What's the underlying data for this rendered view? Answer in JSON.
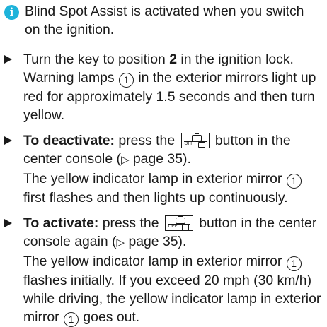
{
  "note": {
    "icon": "info-icon",
    "icon_glyph": "i",
    "text": "Blind Spot Assist is activated when you switch on the ignition."
  },
  "step1": {
    "text_a": "Turn the key to position ",
    "position": "2",
    "text_b": " in the ignition lock. Warning lamps ",
    "callout": "1",
    "text_c": " in the exterior mirrors light up red for approximately 1.5 seconds and then turn yellow."
  },
  "step2": {
    "label": "To deactivate:",
    "text_a": " press the ",
    "button_icon": "blind-spot-assist-button-icon",
    "button_icon_text": "OFF",
    "text_b": " button in the center console (",
    "arrow_glyph": "▷",
    "page_ref": " page 35).",
    "text_c": " The yellow indicator lamp in exterior mirror ",
    "callout": "1",
    "text_d": " first flashes and then lights up continuously."
  },
  "step3": {
    "label": "To activate:",
    "text_a": " press the ",
    "button_icon": "blind-spot-assist-button-icon",
    "button_icon_text": "OFF",
    "text_b": " button in the center console again (",
    "arrow_glyph": "▷",
    "page_ref": " page 35).",
    "text_c": " The yellow indicator lamp in exterior mirror ",
    "callout": "1",
    "text_d": " flashes initially. If you exceed 20 mph (30 km/h) while driving, the yellow indicator lamp in exterior mirror ",
    "callout2": "1",
    "text_e": " goes out."
  }
}
